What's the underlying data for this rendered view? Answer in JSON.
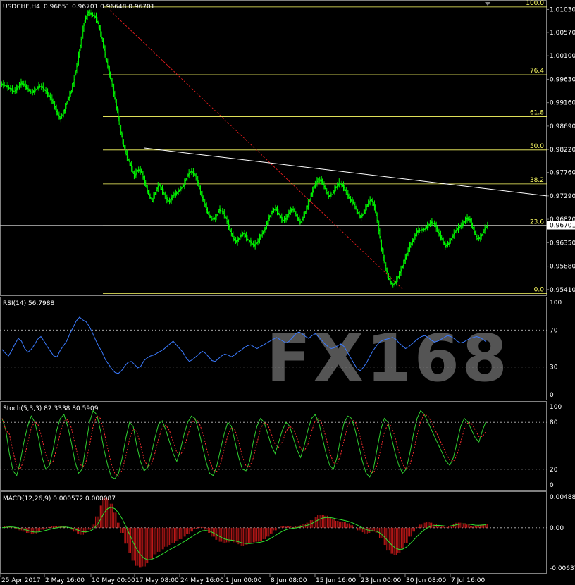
{
  "chart_data": {
    "type": "candlestick",
    "symbol": "USDCHF,H4",
    "ohlc_text": "0.96651 0.96701 0.96648 0.96701",
    "price_axis": [
      1.0103,
      1.0057,
      1.001,
      0.9963,
      0.9916,
      0.9869,
      0.9822,
      0.9776,
      0.9729,
      0.9682,
      0.9635,
      0.9588,
      0.9541
    ],
    "price_axis_labels": [
      "1.01030",
      "1.00570",
      "1.00100",
      "0.99630",
      "0.99160",
      "0.98690",
      "0.98220",
      "0.97760",
      "0.97290",
      "0.96820",
      "0.96350",
      "0.95880",
      "0.95410"
    ],
    "current_price": "0.96701",
    "x_labels": [
      "25 Apr 2017",
      "2 May 16:00",
      "10 May 00:00",
      "17 May 08:00",
      "24 May 16:00",
      "1 Jun 00:00",
      "8 Jun 08:00",
      "15 Jun 16:00",
      "23 Jun 00:00",
      "30 Jun 08:00",
      "7 Jul 16:00"
    ],
    "fibonacci": [
      {
        "level": "100.0",
        "price": 1.0108
      },
      {
        "level": "76.4",
        "price": 0.9972
      },
      {
        "level": "61.8",
        "price": 0.9888
      },
      {
        "level": "50.0",
        "price": 0.9821
      },
      {
        "level": "38.2",
        "price": 0.9753
      },
      {
        "level": "23.6",
        "price": 0.9669
      },
      {
        "level": "0.0",
        "price": 0.9533
      }
    ],
    "close_series": [
      0.9952,
      0.9948,
      0.9943,
      0.9938,
      0.9946,
      0.9955,
      0.9951,
      0.9942,
      0.9936,
      0.9941,
      0.9949,
      0.9947,
      0.9938,
      0.9929,
      0.9917,
      0.9898,
      0.9884,
      0.9895,
      0.9918,
      0.9935,
      0.9962,
      0.9998,
      1.0042,
      1.0081,
      1.0097,
      1.0093,
      1.0088,
      1.007,
      1.0039,
      1.0005,
      0.9974,
      0.9945,
      0.9906,
      0.9865,
      0.983,
      0.9806,
      0.979,
      0.9768,
      0.9781,
      0.9778,
      0.9756,
      0.9733,
      0.9718,
      0.9736,
      0.9752,
      0.9739,
      0.9723,
      0.9717,
      0.973,
      0.9734,
      0.9742,
      0.975,
      0.9769,
      0.9778,
      0.9773,
      0.9756,
      0.973,
      0.9712,
      0.9691,
      0.9682,
      0.9684,
      0.9701,
      0.9697,
      0.9683,
      0.9662,
      0.9644,
      0.9636,
      0.9648,
      0.9654,
      0.9642,
      0.9635,
      0.9629,
      0.9637,
      0.9651,
      0.9662,
      0.9683,
      0.9697,
      0.9704,
      0.9691,
      0.9679,
      0.9684,
      0.9698,
      0.9702,
      0.9687,
      0.9675,
      0.9688,
      0.9708,
      0.9728,
      0.9749,
      0.9761,
      0.9759,
      0.9744,
      0.9728,
      0.9732,
      0.9745,
      0.9755,
      0.9749,
      0.9736,
      0.9722,
      0.9715,
      0.9699,
      0.9685,
      0.9695,
      0.9712,
      0.9722,
      0.9707,
      0.9671,
      0.9623,
      0.9589,
      0.9564,
      0.9549,
      0.9556,
      0.9571,
      0.9589,
      0.9609,
      0.9628,
      0.9641,
      0.9657,
      0.966,
      0.9661,
      0.9668,
      0.9676,
      0.9672,
      0.9656,
      0.9643,
      0.9628,
      0.9633,
      0.9647,
      0.9659,
      0.9666,
      0.9672,
      0.9683,
      0.9681,
      0.9661,
      0.9643,
      0.9645,
      0.966,
      0.967
    ],
    "trendline": {
      "from": [
        "17 May",
        0.9825
      ],
      "to": [
        "end",
        0.9729
      ]
    },
    "diagonal_line": {
      "from": [
        "10 May",
        1.0101
      ],
      "to": [
        "30 Jun",
        0.9541
      ]
    },
    "rsi": {
      "label": "RSI(14) 56.7988",
      "levels": [
        "100",
        "70",
        "30",
        "0"
      ],
      "values": [
        49,
        45,
        42,
        48,
        55,
        61,
        58,
        50,
        46,
        49,
        54,
        60,
        63,
        58,
        52,
        47,
        42,
        41,
        48,
        53,
        58,
        66,
        73,
        80,
        84,
        81,
        79,
        74,
        67,
        59,
        52,
        46,
        38,
        33,
        28,
        24,
        23,
        26,
        31,
        35,
        36,
        33,
        29,
        31,
        37,
        40,
        42,
        43,
        45,
        47,
        49,
        52,
        55,
        58,
        54,
        50,
        46,
        40,
        36,
        38,
        41,
        44,
        47,
        45,
        41,
        37,
        36,
        39,
        42,
        44,
        43,
        41,
        43,
        46,
        48,
        51,
        53,
        54,
        52,
        50,
        52,
        54,
        56,
        58,
        60,
        62,
        60,
        58,
        56,
        58,
        62,
        66,
        68,
        66,
        63,
        61,
        64,
        66,
        63,
        59,
        55,
        52,
        50,
        51,
        53,
        55,
        52,
        46,
        40,
        34,
        28,
        26,
        30,
        35,
        42,
        48,
        53,
        57,
        59,
        60,
        61,
        62,
        60,
        56,
        53,
        50,
        52,
        55,
        58,
        61,
        63,
        64,
        62,
        59,
        57,
        58,
        60,
        62,
        64,
        63,
        61,
        58,
        56,
        57,
        59,
        61,
        62,
        63,
        62,
        60,
        57
      ]
    },
    "stochastic": {
      "label": "Stoch(5,3,3) 82.3338 80.5909",
      "levels": [
        "100",
        "80",
        "20",
        "0"
      ],
      "values": [
        85,
        70,
        40,
        18,
        12,
        30,
        55,
        75,
        88,
        80,
        60,
        35,
        20,
        25,
        45,
        70,
        85,
        90,
        75,
        55,
        30,
        15,
        20,
        50,
        80,
        95,
        90,
        70,
        45,
        25,
        10,
        8,
        15,
        35,
        60,
        80,
        75,
        50,
        30,
        18,
        22,
        40,
        60,
        78,
        82,
        70,
        55,
        40,
        30,
        45,
        65,
        80,
        88,
        85,
        70,
        50,
        30,
        15,
        12,
        25,
        45,
        65,
        80,
        75,
        55,
        35,
        20,
        18,
        30,
        55,
        75,
        85,
        80,
        65,
        50,
        40,
        55,
        70,
        80,
        75,
        60,
        45,
        35,
        50,
        70,
        85,
        90,
        80,
        60,
        40,
        25,
        20,
        35,
        60,
        80,
        88,
        85,
        70,
        50,
        30,
        15,
        10,
        20,
        45,
        70,
        85,
        80,
        60,
        40,
        25,
        15,
        20,
        40,
        65,
        85,
        95,
        90,
        80,
        70,
        60,
        50,
        40,
        30,
        25,
        35,
        55,
        75,
        85,
        80,
        70,
        60,
        55,
        70,
        82
      ]
    },
    "macd": {
      "label": "MACD(12,26,9) 0.000572 0.000087",
      "levels": [
        "0.004883",
        "0.00",
        "-0.006373"
      ],
      "hist": [
        0.0,
        0.0002,
        0.0003,
        0.0001,
        -0.0002,
        -0.0004,
        -0.0006,
        -0.0008,
        -0.001,
        -0.0009,
        -0.0006,
        -0.0003,
        -0.0001,
        0.0001,
        0.0002,
        0.0003,
        0.0003,
        0.0002,
        0.0,
        -0.0003,
        -0.0006,
        -0.0009,
        -0.0011,
        -0.0008,
        -0.0003,
        0.0005,
        0.0018,
        0.0035,
        0.0048,
        0.0046,
        0.0038,
        0.0024,
        0.0008,
        -0.0008,
        -0.0025,
        -0.004,
        -0.0052,
        -0.006,
        -0.0063,
        -0.0061,
        -0.0056,
        -0.0049,
        -0.0042,
        -0.0038,
        -0.0034,
        -0.003,
        -0.0027,
        -0.0024,
        -0.0021,
        -0.0018,
        -0.0014,
        -0.001,
        -0.0006,
        -0.0002,
        0.0001,
        0.0001,
        -0.0003,
        -0.0008,
        -0.0014,
        -0.0019,
        -0.0022,
        -0.0024,
        -0.0023,
        -0.0021,
        -0.0023,
        -0.0026,
        -0.0028,
        -0.0027,
        -0.0025,
        -0.0023,
        -0.0022,
        -0.0021,
        -0.0018,
        -0.0014,
        -0.0009,
        -0.0004,
        0.0,
        0.0002,
        0.0003,
        0.0002,
        0.0001,
        0.0002,
        0.0004,
        0.0006,
        0.0008,
        0.0012,
        0.0017,
        0.002,
        0.0021,
        0.0019,
        0.0016,
        0.0013,
        0.0011,
        0.001,
        0.0009,
        0.0007,
        0.0004,
        0.0,
        -0.0004,
        -0.0007,
        -0.0009,
        -0.0008,
        -0.0006,
        -0.0008,
        -0.0016,
        -0.0027,
        -0.0036,
        -0.0041,
        -0.0043,
        -0.004,
        -0.0033,
        -0.0024,
        -0.0014,
        -0.0006,
        0.0001,
        0.0005,
        0.0008,
        0.0009,
        0.0008,
        0.0006,
        0.0004,
        0.0002,
        0.0001,
        0.0003,
        0.0006,
        0.0008,
        0.0008,
        0.0007,
        0.0005,
        0.0003,
        0.0002,
        0.0004,
        0.0005,
        0.0006
      ]
    },
    "watermark": "FX168"
  }
}
